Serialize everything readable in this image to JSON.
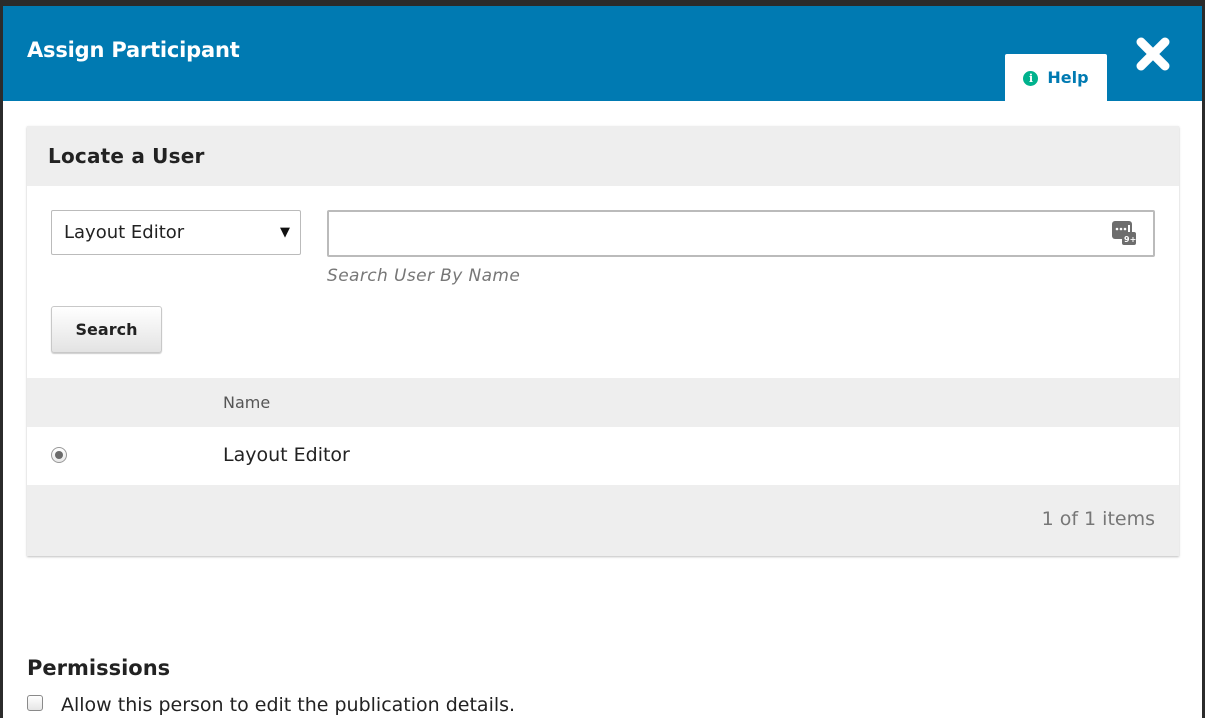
{
  "modal": {
    "title": "Assign Participant",
    "help_label": "Help",
    "help_icon": "info-circle-icon",
    "close_icon": "close-x-icon",
    "header_color": "#007ab2",
    "help_icon_color": "#00b28d"
  },
  "locate_user": {
    "title": "Locate a User",
    "role_select": {
      "selected": "Layout Editor"
    },
    "search": {
      "value": "",
      "placeholder": "",
      "hint": "Search User By Name",
      "button_label": "Search"
    },
    "grid": {
      "columns": [
        "Name"
      ],
      "rows": [
        {
          "name": "Layout Editor",
          "selected": true
        }
      ],
      "count_label": "1 of 1 items"
    }
  },
  "permissions": {
    "title": "Permissions",
    "options": [
      {
        "label": "Allow this person to edit the publication details.",
        "checked": false
      }
    ]
  }
}
